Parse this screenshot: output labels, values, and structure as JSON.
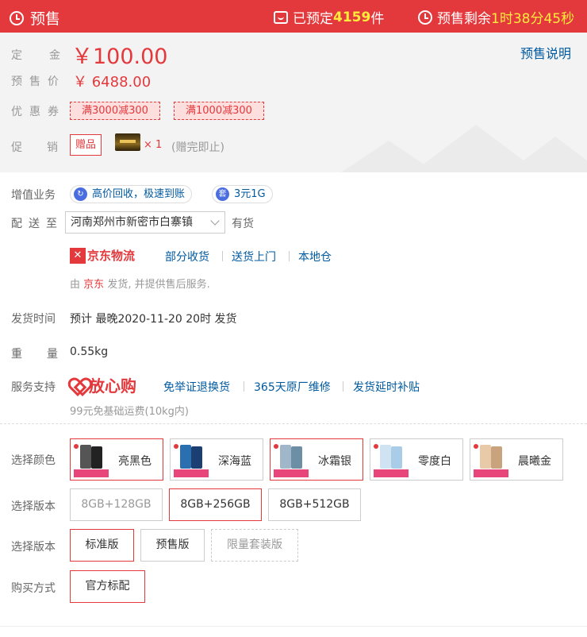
{
  "header": {
    "presale_label": "预售",
    "booked_prefix": "已预定",
    "booked_count": "4159",
    "booked_suffix": "件",
    "remain_prefix": "预售剩余",
    "remain_time": "1时38分45秒"
  },
  "price": {
    "deposit_label": "定金",
    "deposit_value": "￥100.00",
    "presale_label": "预售价",
    "presale_value": "￥ 6488.00",
    "presale_note_link": "预售说明",
    "coupon_label": "优惠券",
    "coupons": [
      "满3000减300",
      "满1000减300"
    ],
    "promo_label": "促销",
    "gift_tag": "赠品",
    "gift_qty": "× 1",
    "gift_note": "(赠完即止)"
  },
  "value_added": {
    "label": "增值业务",
    "items": [
      {
        "icon": "recycle-icon",
        "text": "高价回收，极速到账"
      },
      {
        "icon": "package-icon",
        "icon_char": "套",
        "text": "3元1G"
      }
    ]
  },
  "delivery": {
    "label": "配送至",
    "address": "河南郑州市新密市白寨镇",
    "stock": "有货",
    "logistics_brand": "京东物流",
    "services": [
      "部分收货",
      "送货上门",
      "本地仓"
    ],
    "ship_from_prefix": "由",
    "ship_from_seller": "京东",
    "ship_from_suffix": "发货, 并提供售后服务."
  },
  "ship_time": {
    "label": "发货时间",
    "value": "预计 最晚2020-11-20 20时 发货"
  },
  "weight": {
    "label": "重量",
    "value": "0.55kg"
  },
  "service": {
    "label": "服务支持",
    "brand": "放心购",
    "items": [
      "免举证退换货",
      "365天原厂维修",
      "发货延时补贴"
    ],
    "fee_note": "99元免基础运费(10kg内)"
  },
  "color": {
    "label": "选择颜色",
    "options": [
      "亮黑色",
      "深海蓝",
      "冰霜银",
      "零度白",
      "晨曦金"
    ],
    "selected": [
      "亮黑色",
      "冰霜银"
    ]
  },
  "version": {
    "label": "选择版本",
    "options": [
      "8GB+128GB",
      "8GB+256GB",
      "8GB+512GB"
    ],
    "selected": "8GB+256GB"
  },
  "edition": {
    "label": "选择版本",
    "options": [
      "标准版",
      "预售版",
      "限量套装版"
    ],
    "selected": "标准版"
  },
  "purchase": {
    "label": "购买方式",
    "options": [
      "官方标配"
    ],
    "selected": "官方标配"
  },
  "colors": {
    "accent": "#e4393c",
    "link": "#005aa0",
    "highlight": "#ffeb3b"
  }
}
